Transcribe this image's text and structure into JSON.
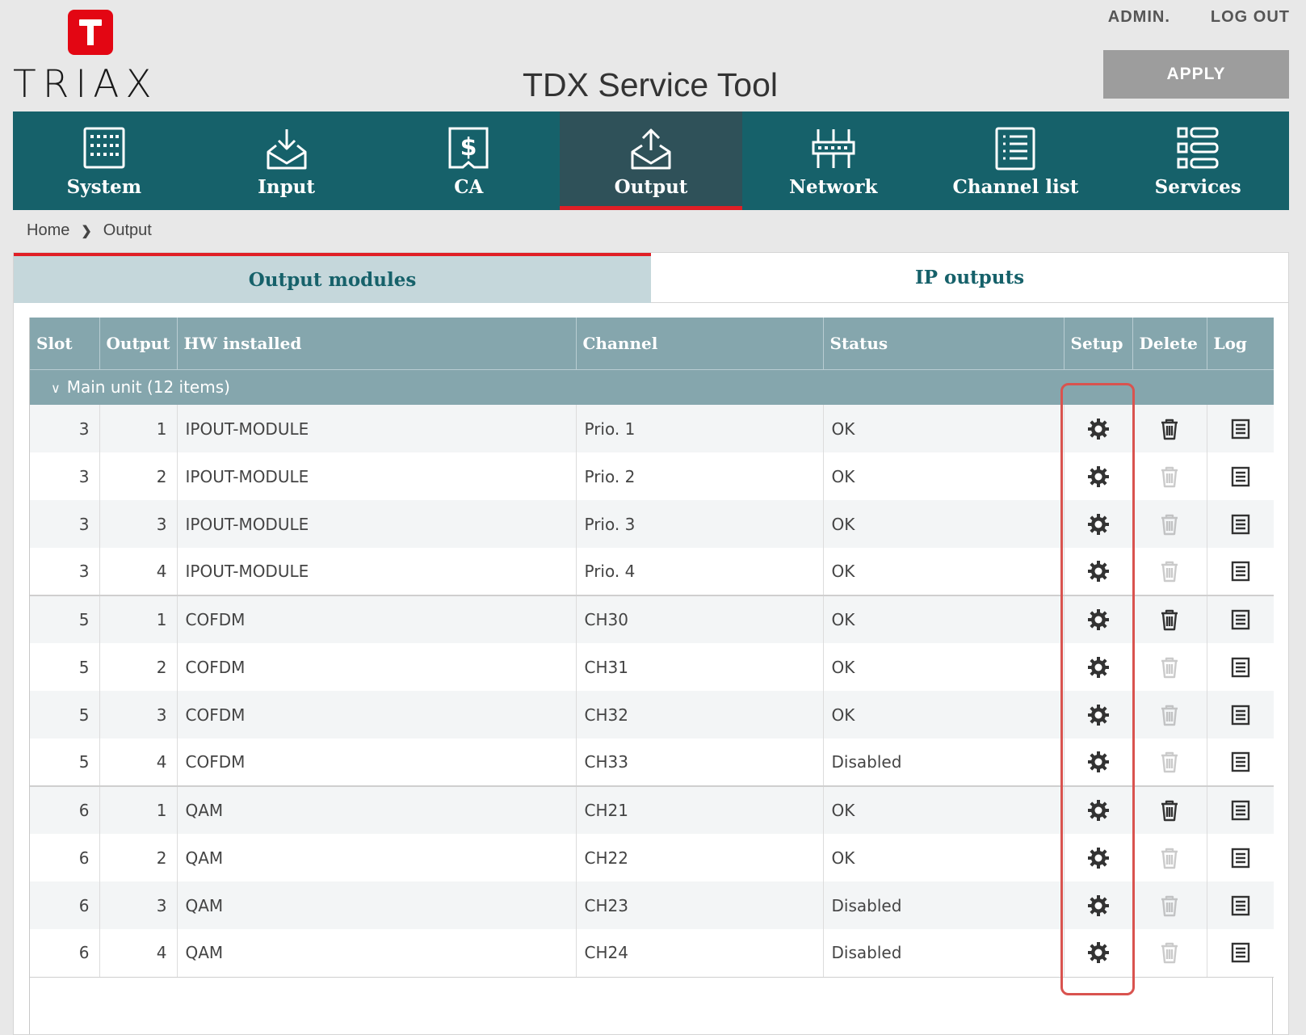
{
  "header": {
    "logo_text": "TRIAX",
    "app_title": "TDX Service Tool",
    "admin_link": "ADMIN.",
    "logout_link": "LOG OUT",
    "apply_label": "APPLY"
  },
  "nav": {
    "items": [
      {
        "label": "System",
        "icon": "system-icon"
      },
      {
        "label": "Input",
        "icon": "input-icon"
      },
      {
        "label": "CA",
        "icon": "ca-icon"
      },
      {
        "label": "Output",
        "icon": "output-icon",
        "active": true
      },
      {
        "label": "Network",
        "icon": "network-icon"
      },
      {
        "label": "Channel list",
        "icon": "channel-list-icon"
      },
      {
        "label": "Services",
        "icon": "services-icon"
      }
    ]
  },
  "breadcrumb": {
    "home": "Home",
    "current": "Output"
  },
  "tabs": [
    {
      "label": "Output modules",
      "active": true
    },
    {
      "label": "IP outputs",
      "active": false
    }
  ],
  "table": {
    "columns": [
      "Slot",
      "Output",
      "HW installed",
      "Channel",
      "Status",
      "Setup",
      "Delete",
      "Log"
    ],
    "group_label": "Main unit (12 items)",
    "rows": [
      {
        "slot": "3",
        "output": "1",
        "hw": "IPOUT-MODULE",
        "channel": "Prio. 1",
        "status": "OK",
        "delete_enabled": true
      },
      {
        "slot": "3",
        "output": "2",
        "hw": "IPOUT-MODULE",
        "channel": "Prio. 2",
        "status": "OK",
        "delete_enabled": false
      },
      {
        "slot": "3",
        "output": "3",
        "hw": "IPOUT-MODULE",
        "channel": "Prio. 3",
        "status": "OK",
        "delete_enabled": false
      },
      {
        "slot": "3",
        "output": "4",
        "hw": "IPOUT-MODULE",
        "channel": "Prio. 4",
        "status": "OK",
        "delete_enabled": false
      },
      {
        "slot": "5",
        "output": "1",
        "hw": "COFDM",
        "channel": "CH30",
        "status": "OK",
        "delete_enabled": true
      },
      {
        "slot": "5",
        "output": "2",
        "hw": "COFDM",
        "channel": "CH31",
        "status": "OK",
        "delete_enabled": false
      },
      {
        "slot": "5",
        "output": "3",
        "hw": "COFDM",
        "channel": "CH32",
        "status": "OK",
        "delete_enabled": false
      },
      {
        "slot": "5",
        "output": "4",
        "hw": "COFDM",
        "channel": "CH33",
        "status": "Disabled",
        "delete_enabled": false
      },
      {
        "slot": "6",
        "output": "1",
        "hw": "QAM",
        "channel": "CH21",
        "status": "OK",
        "delete_enabled": true
      },
      {
        "slot": "6",
        "output": "2",
        "hw": "QAM",
        "channel": "CH22",
        "status": "OK",
        "delete_enabled": false
      },
      {
        "slot": "6",
        "output": "3",
        "hw": "QAM",
        "channel": "CH23",
        "status": "Disabled",
        "delete_enabled": false
      },
      {
        "slot": "6",
        "output": "4",
        "hw": "QAM",
        "channel": "CH24",
        "status": "Disabled",
        "delete_enabled": false
      }
    ]
  },
  "colors": {
    "nav_bg": "#16616a",
    "nav_active_bg": "#2f5159",
    "accent_red": "#e01f26",
    "header_row": "#85a6ad",
    "highlight": "#d9534f"
  }
}
